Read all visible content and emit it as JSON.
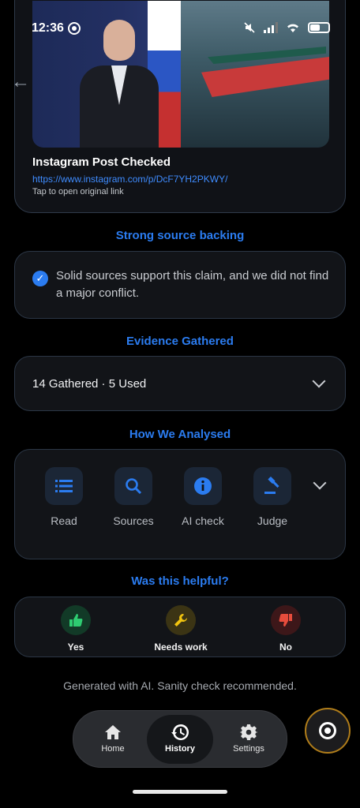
{
  "status_bar": {
    "time": "12:36"
  },
  "post": {
    "title": "Instagram Post Checked",
    "link": "https://www.instagram.com/p/DcF7YH2PKWY/",
    "hint": "Tap to open original link"
  },
  "source_backing": {
    "heading": "Strong source backing",
    "text": "Solid sources support this claim, and we did not find a major conflict."
  },
  "evidence": {
    "heading": "Evidence Gathered",
    "summary": "14 Gathered · 5 Used"
  },
  "analysis": {
    "heading": "How We Analysed",
    "steps": [
      {
        "label": "Read",
        "icon": "list-icon"
      },
      {
        "label": "Sources",
        "icon": "search-icon"
      },
      {
        "label": "AI check",
        "icon": "info-icon"
      },
      {
        "label": "Judge",
        "icon": "gavel-icon"
      }
    ]
  },
  "feedback": {
    "heading": "Was this helpful?",
    "options": [
      {
        "label": "Yes",
        "icon": "thumbs-up-icon",
        "color": "#2ecc71"
      },
      {
        "label": "Needs work",
        "icon": "wrench-icon",
        "color": "#f1c40f"
      },
      {
        "label": "No",
        "icon": "thumbs-down-icon",
        "color": "#e74c3c"
      }
    ]
  },
  "disclaimer": "Generated with AI. Sanity check recommended.",
  "nav": {
    "items": [
      {
        "label": "Home",
        "icon": "home-icon"
      },
      {
        "label": "History",
        "icon": "history-icon",
        "active": true
      },
      {
        "label": "Settings",
        "icon": "gear-icon"
      }
    ]
  },
  "colors": {
    "accent": "#2b7cf0",
    "background": "#000000",
    "card": "#121418"
  }
}
